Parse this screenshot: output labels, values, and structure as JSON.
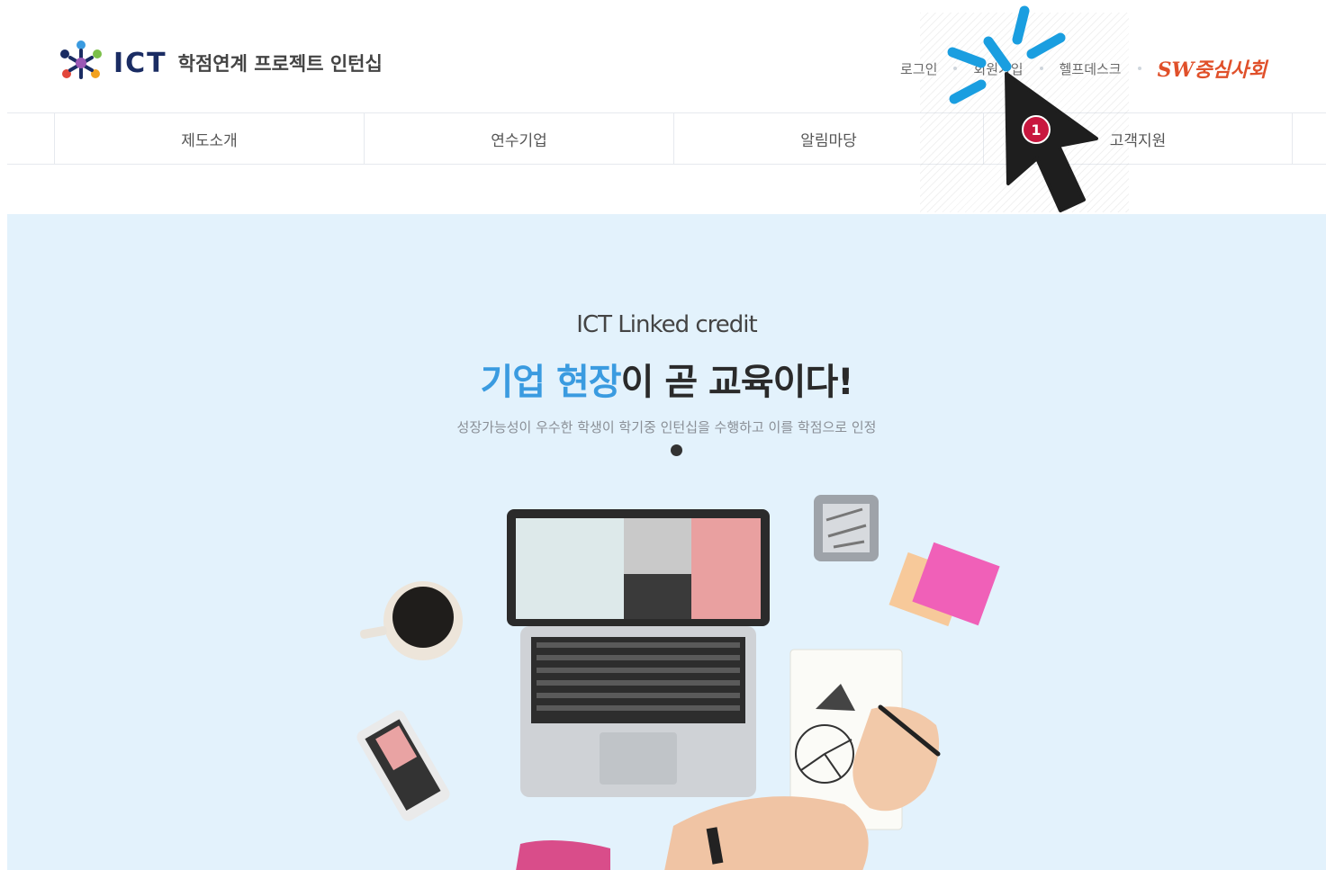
{
  "header": {
    "logo_ict": "ICT",
    "logo_title": "학점연계 프로젝트 인턴십",
    "util_links": [
      {
        "label": "로그인"
      },
      {
        "label": "회원가입"
      },
      {
        "label": "헬프데스크"
      }
    ],
    "brand_label": "SW중심사회"
  },
  "nav": {
    "items": [
      {
        "label": "제도소개"
      },
      {
        "label": "연수기업"
      },
      {
        "label": "알림마당"
      },
      {
        "label": "고객지원"
      }
    ]
  },
  "hero": {
    "eyebrow": "ICT Linked credit",
    "title_highlight": "기업 현장",
    "title_rest": "이 곧 교육이다!",
    "subtitle": "성장가능성이 우수한 학생이 학기중 인턴십을 수행하고 이를 학점으로 인정"
  },
  "annotation": {
    "step_number": "1"
  },
  "colors": {
    "hero_bg": "#e3f2fc",
    "title_highlight": "#3a9be0",
    "badge": "#c8173f",
    "click_burst": "#1a9ee0"
  }
}
